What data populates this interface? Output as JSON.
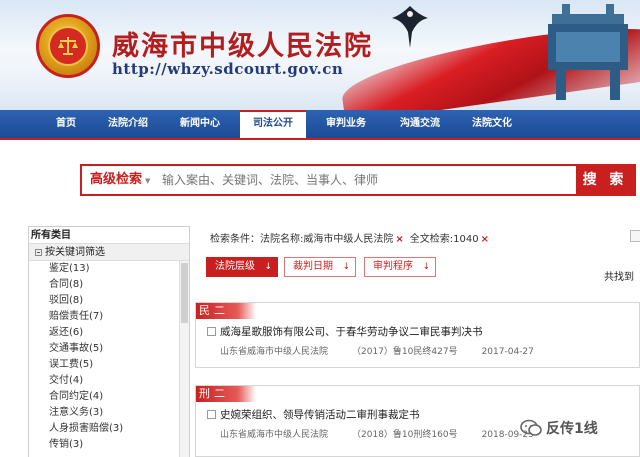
{
  "header": {
    "title": "威海市中级人民法院",
    "url": "http://whzy.sdcourt.gov.cn"
  },
  "nav": {
    "items": [
      "首页",
      "法院介绍",
      "新闻中心",
      "司法公开",
      "审判业务",
      "沟通交流",
      "法院文化"
    ],
    "active_index": 3
  },
  "search": {
    "type_label": "高级检索",
    "placeholder": "输入案由、关键词、法院、当事人、律师",
    "button_label": "搜 索"
  },
  "sidebar": {
    "title": "所有类目",
    "group_label": "按关键词筛选",
    "items": [
      "鉴定(13)",
      "合同(8)",
      "驳回(8)",
      "赔偿责任(7)",
      "返还(6)",
      "交通事故(5)",
      "误工费(5)",
      "交付(4)",
      "合同约定(4)",
      "注意义务(3)",
      "人身损害赔偿(3)",
      "传销(3)"
    ]
  },
  "filters": {
    "prefix": "检索条件：",
    "court_filter": "法院名称:威海市中级人民法院",
    "fulltext_filter": "全文检索:1040",
    "remove_symbol": "×"
  },
  "sort": {
    "buttons": [
      "法院层级",
      "裁判日期",
      "审判程序"
    ],
    "active_index": 0,
    "arrow": "↓"
  },
  "results": {
    "total_text": "共找到",
    "cases": [
      {
        "category": "民二",
        "title": "威海星歌服饰有限公司、于春华劳动争议二审民事判决书",
        "court": "山东省威海市中级人民法院",
        "case_no": "（2017）鲁10民终427号",
        "date": "2017-04-27"
      },
      {
        "category": "刑二",
        "title": "史婉荣组织、领导传销活动二审刑事裁定书",
        "court": "山东省威海市中级人民法院",
        "case_no": "（2018）鲁10刑终160号",
        "date": "2018-09-25"
      }
    ]
  },
  "watermark": {
    "text": "反传1线"
  },
  "colors": {
    "brand_red": "#c9201f",
    "nav_blue": "#1d4a93"
  }
}
